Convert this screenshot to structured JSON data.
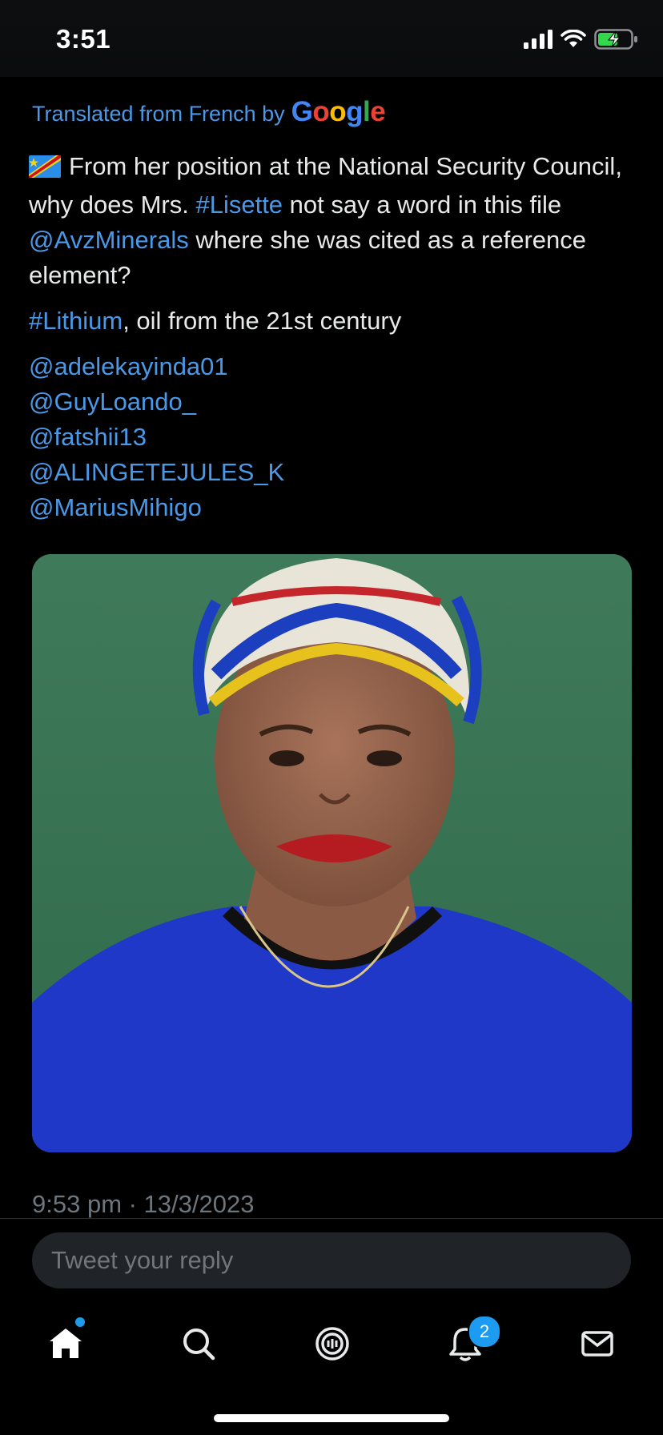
{
  "status_bar": {
    "time": "3:51"
  },
  "translation": {
    "label": "Translated from French by",
    "brand": "Google"
  },
  "tweet": {
    "flag_icon": "drc-flag-emoji",
    "para1_a": "From her position at the National Security Council, why does Mrs.",
    "hashtag_lisette": "#Lisette",
    "para1_b": "not say a word in this file",
    "mention_avz": "@AvzMinerals",
    "para1_c": "where she was cited as a reference element?",
    "hashtag_lithium": "#Lithium",
    "para2_rest": ", oil from the 21st century",
    "mentions": [
      "@adelekayinda01",
      "@GuyLoando_",
      "@fatshii13",
      "@ALINGETEJULES_K",
      "@MariusMihigo"
    ],
    "timestamp": "9:53 pm · 13/3/2023"
  },
  "media": {
    "alt": ""
  },
  "reply": {
    "placeholder": "Tweet your reply"
  },
  "tab_bar": {
    "items": [
      "home-icon",
      "search-icon",
      "spaces-icon",
      "notifications-icon",
      "messages-icon"
    ],
    "notifications_badge": "2"
  },
  "colors": {
    "link": "#4a99e9",
    "accent": "#1d9bf0",
    "background": "#000000"
  }
}
